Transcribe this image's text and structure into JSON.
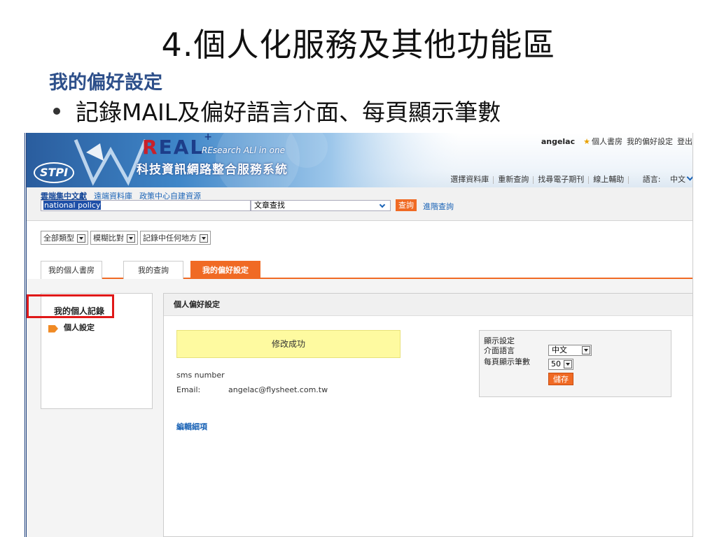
{
  "slide": {
    "title": "4.個人化服務及其他功能區",
    "subtitle": "我的偏好設定",
    "bullet": "記錄MAIL及偏好語言介面、每頁顯示筆數"
  },
  "header": {
    "logo_main": "EAL",
    "logo_first": "R",
    "logo_sup": "+",
    "logo_tagline": "REsearch ALl in one",
    "logo_cn": "科技資訊網路整合服務系統",
    "stpi": "STPI",
    "username": "angelac",
    "user_links": [
      "個人書房",
      "我的偏好設定",
      "登出"
    ],
    "top_links": [
      "選擇資料庫",
      "重新查詢",
      "找尋電子期刊",
      "線上輔助"
    ],
    "lang_label": "語言:",
    "lang_value": "中文"
  },
  "search": {
    "db_tabs": [
      "雲端集中文獻",
      "遠端資料庫",
      "政策中心自建資源"
    ],
    "query": "national policy",
    "field": "文章查找",
    "search_button": "查詢",
    "advanced_link": "進階查詢"
  },
  "filters": [
    "全部類型",
    "模糊比對",
    "記錄中任何地方"
  ],
  "tabs": [
    "我的個人書房",
    "我的查詢",
    "我的偏好設定"
  ],
  "sidebar": {
    "title": "我的個人記錄",
    "item": "個人設定"
  },
  "panel": {
    "title": "個人偏好設定",
    "success_message": "修改成功",
    "sms_label": "sms number",
    "email_label": "Email:",
    "email_value": "angelac@flysheet.com.tw",
    "edit_link": "編輯細項",
    "display_settings": {
      "title": "顯示設定",
      "lang_label": "介面語言",
      "lang_value": "中文",
      "rows_label": "每頁顯示筆數",
      "rows_value": "50",
      "save_button": "儲存"
    }
  },
  "colors": {
    "accent": "#f06a24",
    "link": "#1a63b6",
    "highlight_box": "#e01818",
    "success_bg": "#fefaa0"
  }
}
